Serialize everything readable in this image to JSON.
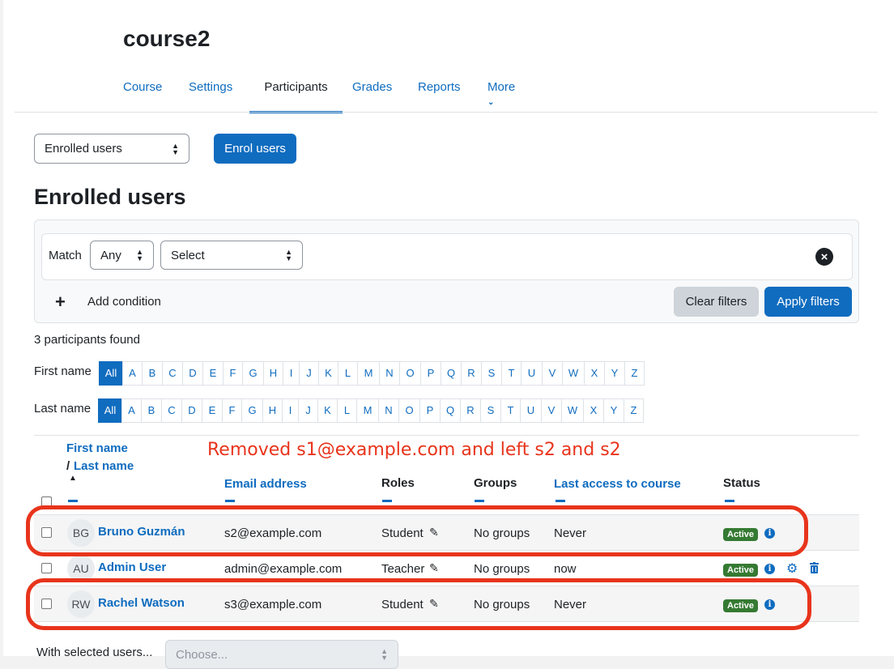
{
  "course": {
    "title": "course2"
  },
  "nav": {
    "tabs": [
      "Course",
      "Settings",
      "Participants",
      "Grades",
      "Reports"
    ],
    "more_label": "More"
  },
  "enrol_select": {
    "value": "Enrolled users"
  },
  "enrol_button": {
    "label": "Enrol users"
  },
  "heading": "Enrolled users",
  "filter": {
    "match_label": "Match",
    "match_value": "Any",
    "condition_value": "Select",
    "add_condition": "Add condition",
    "clear_filters": "Clear filters",
    "apply_filters": "Apply filters"
  },
  "participants_found": "3 participants found",
  "initials_bar": {
    "first_name_label": "First name",
    "last_name_label": "Last name",
    "letters": [
      "All",
      "A",
      "B",
      "C",
      "D",
      "E",
      "F",
      "G",
      "H",
      "I",
      "J",
      "K",
      "L",
      "M",
      "N",
      "O",
      "P",
      "Q",
      "R",
      "S",
      "T",
      "U",
      "V",
      "W",
      "X",
      "Y",
      "Z"
    ]
  },
  "annotation": "Removed s1@example.com and left s2 and s2",
  "table": {
    "headers": {
      "first_name": "First name",
      "separator": "/",
      "last_name": "Last name",
      "email": "Email address",
      "roles": "Roles",
      "groups": "Groups",
      "last_access": "Last access to course",
      "status": "Status"
    },
    "rows": [
      {
        "initials": "BG",
        "name": "Bruno Guzmán",
        "email": "s2@example.com",
        "role": "Student",
        "groups": "No groups",
        "last_access": "Never",
        "status": "Active"
      },
      {
        "initials": "AU",
        "name": "Admin User",
        "email": "admin@example.com",
        "role": "Teacher",
        "groups": "No groups",
        "last_access": "now",
        "status": "Active"
      },
      {
        "initials": "RW",
        "name": "Rachel Watson",
        "email": "s3@example.com",
        "role": "Student",
        "groups": "No groups",
        "last_access": "Never",
        "status": "Active"
      }
    ]
  },
  "bulk": {
    "label": "With selected users...",
    "select_value": "Choose..."
  },
  "colors": {
    "primary": "#0f6cbf",
    "success": "#357a32",
    "annotation_red": "#e8341c"
  }
}
